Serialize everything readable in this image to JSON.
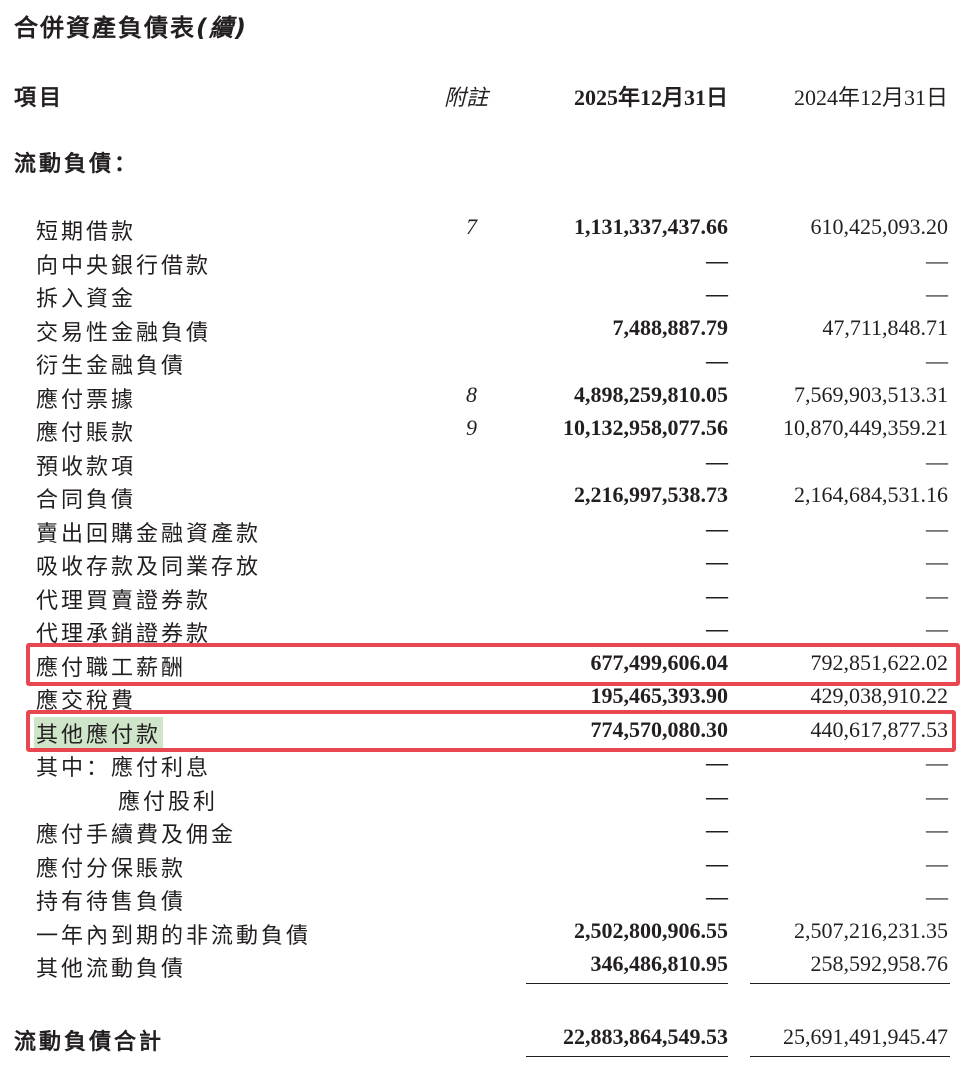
{
  "title": "合併資產負債表",
  "title_cont": "(續)",
  "header": {
    "item": "項目",
    "note": "附註",
    "current": "2025年12月31日",
    "previous": "2024年12月31日"
  },
  "section": "流動負債：",
  "rows": [
    {
      "label": "短期借款",
      "note": "7",
      "current": "1,131,337,437.66",
      "previous": "610,425,093.20"
    },
    {
      "label": "向中央銀行借款",
      "note": "",
      "current": "—",
      "previous": "—"
    },
    {
      "label": "拆入資金",
      "note": "",
      "current": "—",
      "previous": "—"
    },
    {
      "label": "交易性金融負債",
      "note": "",
      "current": "7,488,887.79",
      "previous": "47,711,848.71"
    },
    {
      "label": "衍生金融負債",
      "note": "",
      "current": "—",
      "previous": "—"
    },
    {
      "label": "應付票據",
      "note": "8",
      "current": "4,898,259,810.05",
      "previous": "7,569,903,513.31"
    },
    {
      "label": "應付賬款",
      "note": "9",
      "current": "10,132,958,077.56",
      "previous": "10,870,449,359.21"
    },
    {
      "label": "預收款項",
      "note": "",
      "current": "—",
      "previous": "—"
    },
    {
      "label": "合同負債",
      "note": "",
      "current": "2,216,997,538.73",
      "previous": "2,164,684,531.16"
    },
    {
      "label": "賣出回購金融資產款",
      "note": "",
      "current": "—",
      "previous": "—"
    },
    {
      "label": "吸收存款及同業存放",
      "note": "",
      "current": "—",
      "previous": "—"
    },
    {
      "label": "代理買賣證券款",
      "note": "",
      "current": "—",
      "previous": "—"
    },
    {
      "label": "代理承銷證券款",
      "note": "",
      "current": "—",
      "previous": "—"
    },
    {
      "label": "應付職工薪酬",
      "note": "",
      "current": "677,499,606.04",
      "previous": "792,851,622.02"
    },
    {
      "label": "應交稅費",
      "note": "",
      "current": "195,465,393.90",
      "previous": "429,038,910.22"
    },
    {
      "label": "其他應付款",
      "note": "",
      "current": "774,570,080.30",
      "previous": "440,617,877.53"
    },
    {
      "label": "其中：應付利息",
      "note": "",
      "current": "—",
      "previous": "—"
    },
    {
      "label": "應付股利",
      "note": "",
      "current": "—",
      "previous": "—"
    },
    {
      "label": "應付手續費及佣金",
      "note": "",
      "current": "—",
      "previous": "—"
    },
    {
      "label": "應付分保賬款",
      "note": "",
      "current": "—",
      "previous": "—"
    },
    {
      "label": "持有待售負債",
      "note": "",
      "current": "—",
      "previous": "—"
    },
    {
      "label": "一年內到期的非流動負債",
      "note": "",
      "current": "2,502,800,906.55",
      "previous": "2,507,216,231.35"
    },
    {
      "label": "其他流動負債",
      "note": "",
      "current": "346,486,810.95",
      "previous": "258,592,958.76"
    }
  ],
  "total": {
    "label": "流動負債合計",
    "current": "22,883,864,549.53",
    "previous": "25,691,491,945.47"
  },
  "colors": {
    "highlight_box": "#e8474f",
    "highlight_text_bg": "#cfe5c9"
  }
}
